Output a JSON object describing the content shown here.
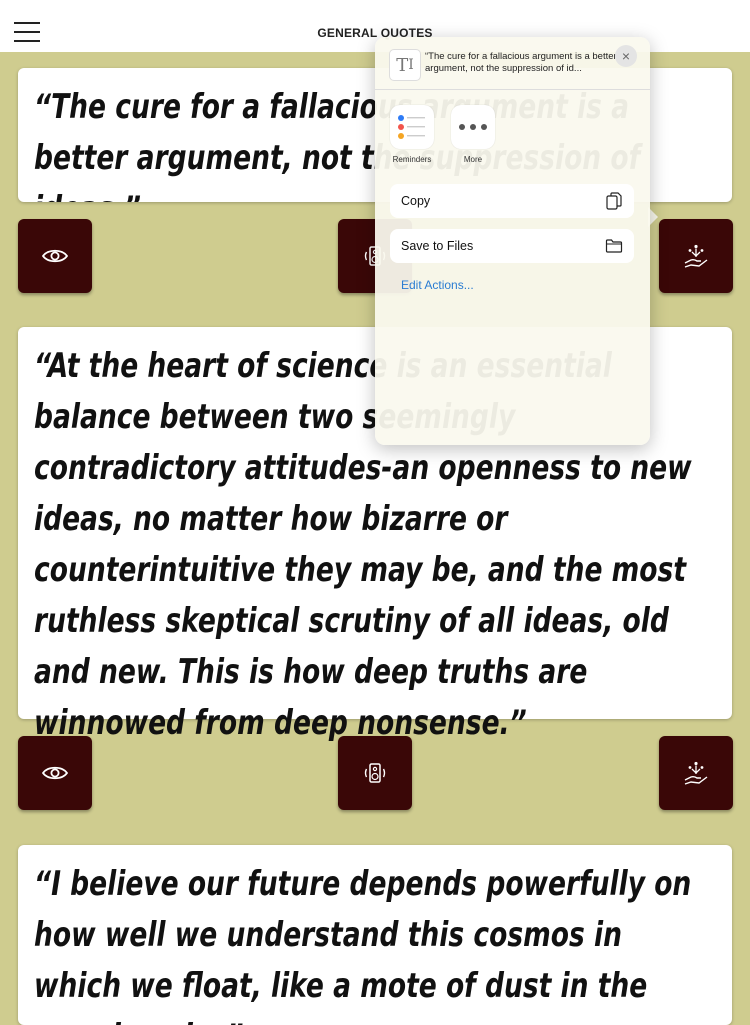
{
  "header": {
    "title": "GENERAL QUOTES"
  },
  "quotes": [
    {
      "text": "“The cure for a fallacious argument is a better argument, not the suppression of ideas.”"
    },
    {
      "text": "“At the heart of science is an essential balance between two seemingly contradictory attitudes-an openness to new ideas, no matter how bizarre or counterintuitive they may be, and the most ruthless skeptical scrutiny of all ideas, old and new. This is how deep truths are winnowed from deep nonsense.”"
    },
    {
      "text": "“I believe our future depends powerfully on how well we understand this cosmos in which we float, like a mote of dust in the morning sky.”"
    }
  ],
  "action_icons": [
    "eye-icon",
    "speaker-icon",
    "hand-share-icon"
  ],
  "share_sheet": {
    "preview": "“The cure for a fallacious argument is a better argument, not the suppression of id...",
    "close_glyph": "×",
    "apps": [
      {
        "label": "Reminders"
      },
      {
        "label": "More"
      }
    ],
    "actions": [
      {
        "label": "Copy"
      },
      {
        "label": "Save to Files"
      }
    ],
    "edit_actions_label": "Edit Actions..."
  },
  "colors": {
    "background": "#cfcc8f",
    "button": "#3a0707",
    "link": "#2a7cd2"
  }
}
